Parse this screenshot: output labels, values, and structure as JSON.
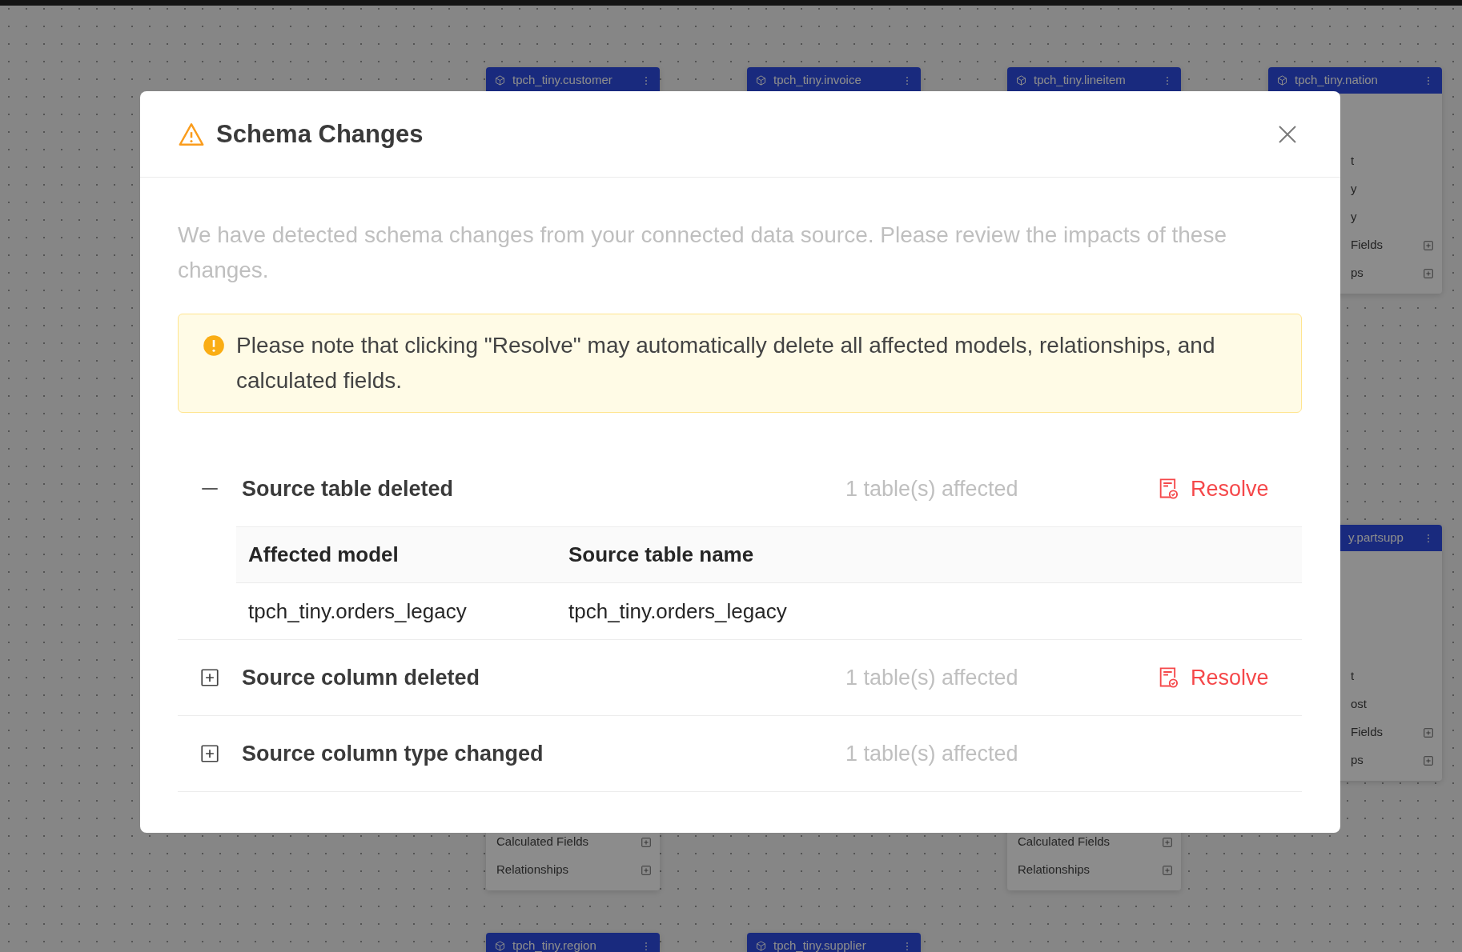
{
  "canvas": {
    "models": [
      {
        "title": "tpch_tiny.customer",
        "rows": [
          {
            "label": "Calculated Fields",
            "kind": "group"
          },
          {
            "label": "Relationships",
            "kind": "group"
          }
        ]
      },
      {
        "title": "tpch_tiny.invoice"
      },
      {
        "title": "tpch_tiny.lineitem",
        "rows": [
          {
            "label": "Calculated Fields",
            "kind": "group"
          },
          {
            "label": "Relationships",
            "kind": "group"
          }
        ]
      },
      {
        "title": "tpch_tiny.nation",
        "rows": [
          {
            "label": "t",
            "kind": "field"
          },
          {
            "label": "y",
            "kind": "field"
          },
          {
            "label": "y",
            "kind": "field"
          },
          {
            "label": "Fields",
            "kind": "group"
          },
          {
            "label": "ps",
            "kind": "group"
          }
        ]
      },
      {
        "title": "y.partsupp",
        "rows": [
          {
            "label": "t",
            "kind": "field"
          },
          {
            "label": "ost",
            "kind": "field"
          },
          {
            "label": "Fields",
            "kind": "group"
          },
          {
            "label": "ps",
            "kind": "group"
          }
        ]
      },
      {
        "title": "tpch_tiny.region"
      },
      {
        "title": "tpch_tiny.supplier"
      }
    ]
  },
  "modal": {
    "title": "Schema Changes",
    "description": "We have detected schema changes from your connected data source. Please review the impacts of these changes.",
    "alert": "Please note that clicking \"Resolve\" may automatically delete all affected models, relationships, and calculated fields.",
    "sections": [
      {
        "title": "Source table deleted",
        "affected": "1 table(s) affected",
        "expanded": true,
        "resolve": "Resolve",
        "table": {
          "columns": [
            "Affected model",
            "Source table name"
          ],
          "rows": [
            [
              "tpch_tiny.orders_legacy",
              "tpch_tiny.orders_legacy"
            ]
          ]
        }
      },
      {
        "title": "Source column deleted",
        "affected": "1 table(s) affected",
        "expanded": false,
        "resolve": "Resolve"
      },
      {
        "title": "Source column type changed",
        "affected": "1 table(s) affected",
        "expanded": false
      }
    ]
  }
}
